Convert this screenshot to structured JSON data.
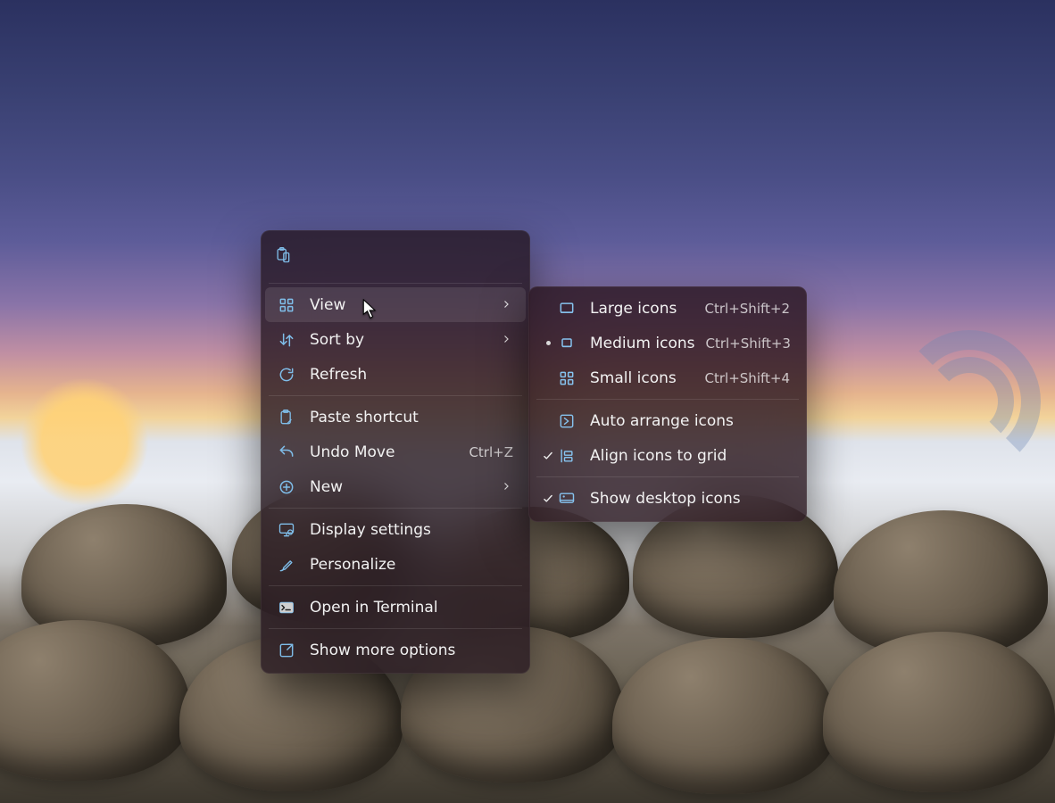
{
  "context_menu": {
    "toolbar_icon": "paste-icon",
    "items": [
      {
        "id": "view",
        "icon": "grid-icon",
        "label": "View",
        "hotkey": "",
        "submenu": true,
        "hovered": true
      },
      {
        "id": "sort-by",
        "icon": "sort-icon",
        "label": "Sort by",
        "hotkey": "",
        "submenu": true,
        "hovered": false
      },
      {
        "id": "refresh",
        "icon": "refresh-icon",
        "label": "Refresh",
        "hotkey": "",
        "submenu": false,
        "hovered": false
      }
    ],
    "group2": [
      {
        "id": "paste-shortcut",
        "icon": "paste-shortcut-icon",
        "label": "Paste shortcut",
        "hotkey": "",
        "submenu": false
      },
      {
        "id": "undo-move",
        "icon": "undo-icon",
        "label": "Undo Move",
        "hotkey": "Ctrl+Z",
        "submenu": false
      },
      {
        "id": "new",
        "icon": "plus-circle-icon",
        "label": "New",
        "hotkey": "",
        "submenu": true
      }
    ],
    "group3": [
      {
        "id": "display-settings",
        "icon": "display-gear-icon",
        "label": "Display settings",
        "hotkey": "",
        "submenu": false
      },
      {
        "id": "personalize",
        "icon": "brush-icon",
        "label": "Personalize",
        "hotkey": "",
        "submenu": false
      }
    ],
    "group4": [
      {
        "id": "open-terminal",
        "icon": "terminal-icon",
        "label": "Open in Terminal",
        "hotkey": "",
        "submenu": false
      }
    ],
    "group5": [
      {
        "id": "show-more",
        "icon": "expand-icon",
        "label": "Show more options",
        "hotkey": "",
        "submenu": false
      }
    ]
  },
  "view_submenu": {
    "size_items": [
      {
        "id": "large-icons",
        "icon": "large-thumb-icon",
        "label": "Large icons",
        "hotkey": "Ctrl+Shift+2",
        "selected": false
      },
      {
        "id": "medium-icons",
        "icon": "medium-thumb-icon",
        "label": "Medium icons",
        "hotkey": "Ctrl+Shift+3",
        "selected": true
      },
      {
        "id": "small-icons",
        "icon": "small-grid-icon",
        "label": "Small icons",
        "hotkey": "Ctrl+Shift+4",
        "selected": false
      }
    ],
    "arrange_items": [
      {
        "id": "auto-arrange",
        "icon": "auto-arrange-icon",
        "label": "Auto arrange icons",
        "checked": false
      },
      {
        "id": "align-grid",
        "icon": "align-grid-icon",
        "label": "Align icons to grid",
        "checked": true
      }
    ],
    "last_items": [
      {
        "id": "show-desktop-icons",
        "icon": "desktop-icon",
        "label": "Show desktop icons",
        "checked": true
      }
    ]
  }
}
